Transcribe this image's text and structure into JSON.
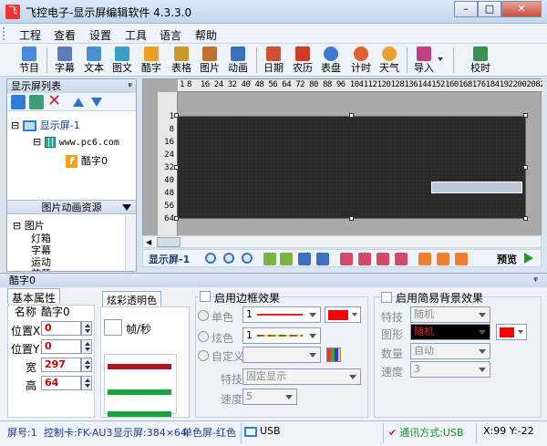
{
  "window": {
    "title": "飞控电子-显示屏编辑软件 4.3.3.0",
    "icon": "app-icon",
    "min": "–",
    "max": "□",
    "close": "✕"
  },
  "menu": [
    "工程",
    "查看",
    "设置",
    "工具",
    "语言",
    "帮助"
  ],
  "toolbar": [
    {
      "label": "节目",
      "icon": "program-icon",
      "color": "#4a8ad8"
    },
    {
      "label": "字幕",
      "icon": "subtitle-icon",
      "color": "#5a7fb8"
    },
    {
      "label": "文本",
      "icon": "text-icon",
      "color": "#4c8fd0"
    },
    {
      "label": "图文",
      "icon": "image-text-icon",
      "color": "#3aa0c8"
    },
    {
      "label": "酷字",
      "icon": "cool-text-icon",
      "color": "#f0a020"
    },
    {
      "label": "表格",
      "icon": "table-icon",
      "color": "#c79a2a"
    },
    {
      "label": "图片",
      "icon": "picture-icon",
      "color": "#c07030"
    },
    {
      "label": "动画",
      "icon": "animation-icon",
      "color": "#3a70c0"
    },
    {
      "label": "日期",
      "icon": "date-icon",
      "color": "#d05030"
    },
    {
      "label": "农历",
      "icon": "lunar-icon",
      "color": "#d03a20"
    },
    {
      "label": "表盘",
      "icon": "clock-icon",
      "color": "#3a7ad0"
    },
    {
      "label": "计时",
      "icon": "timer-icon",
      "color": "#e06030"
    },
    {
      "label": "天气",
      "icon": "weather-icon",
      "color": "#e8a030"
    },
    {
      "label": "导入",
      "icon": "import-icon",
      "color": "#c04080"
    },
    {
      "label": "校时",
      "icon": "time-sync-icon",
      "color": "#3a9050"
    }
  ],
  "left_panel": {
    "title": "显示屏列表",
    "pin": "ᵠ",
    "tree": [
      {
        "label": "显示屏-1",
        "kind": "screen"
      },
      {
        "label": "www.pc6.com",
        "kind": "program"
      },
      {
        "label": "酷字0",
        "kind": "cooltext"
      }
    ],
    "resources_title": "图片动画资源",
    "resources": [
      "图片",
      "灯箱",
      "字幕",
      "运动",
      "花草"
    ]
  },
  "ruler_h": [
    "1",
    "8",
    "16",
    "24",
    "32",
    "40",
    "48",
    "56",
    "64",
    "72",
    "80",
    "88",
    "96",
    "104",
    "112",
    "120",
    "128",
    "136",
    "144",
    "152",
    "160",
    "168",
    "176",
    "184",
    "192",
    "200",
    "208",
    "216"
  ],
  "ruler_v": [
    "1",
    "8",
    "16",
    "24",
    "32",
    "40",
    "48",
    "56",
    "64"
  ],
  "screen_bar": {
    "label": "显示屏-1",
    "preview": "预览"
  },
  "bottom": {
    "title": "酷字0",
    "tabs": [
      "基本属性",
      "炫彩透明色"
    ],
    "basic": {
      "name_label": "名称",
      "name_value": "酷字0",
      "x_label": "位置X",
      "x_value": "0",
      "y_label": "位置Y",
      "y_value": "0",
      "w_label": "宽",
      "w_value": "297",
      "h_label": "高",
      "h_value": "64"
    },
    "speed_unit": "帧/秒",
    "border": {
      "enable_label": "启用边框效果",
      "mono_label": "单色",
      "mono_value": "1",
      "colorful_label": "炫色",
      "colorful_value": "1",
      "custom_label": "自定义",
      "effect_label": "特技",
      "effect_value": "固定显示",
      "speed_label": "速度",
      "speed_value": "5",
      "color": "#ff0000"
    },
    "background": {
      "enable_label": "启用简易背景效果",
      "effect_label": "特技",
      "effect_value": "随机",
      "shape_label": "图形",
      "shape_value": "随机",
      "count_label": "数量",
      "count_value": "自动",
      "speed_label": "速度",
      "speed_value": "3",
      "color": "#ff0000"
    }
  },
  "status": {
    "screen_no": "屏号:1",
    "card": "控制卡:FK-AU3",
    "size": "显示屏:384×64",
    "mode": "单色屏-红色",
    "port": "USB",
    "comm": "通讯方式:USB",
    "coords": "X:99 Y:-22"
  }
}
